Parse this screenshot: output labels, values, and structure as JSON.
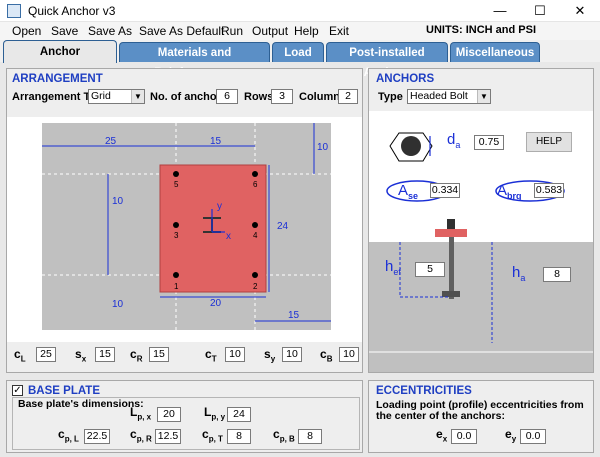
{
  "window": {
    "title": "Quick Anchor v3",
    "minimize": "—",
    "maximize": "☐",
    "close": "✕"
  },
  "menu": [
    "Open",
    "Save",
    "Save As",
    "Save As Default",
    "Run",
    "Output",
    "Help",
    "Exit"
  ],
  "units": "UNITS: INCH and PSI",
  "tabs": [
    "Anchor Arrangement",
    "Materials and Reinforcement",
    "Load",
    "Post-installed Anchors",
    "Miscellaneous"
  ],
  "arrangement": {
    "title": "ARRANGEMENT",
    "type_label": "Arrangement  Type",
    "type_value": "Grid",
    "num_anchors_label": "No. of anchors",
    "num_anchors": "6",
    "rows_label": "Rows",
    "rows": "3",
    "columns_label": "Columns",
    "columns": "2",
    "diagram": {
      "dim_top_left": "25",
      "dim_top_mid": "15",
      "dim_top_right": "10",
      "dim_left_upper": "10",
      "dim_left_lower": "10",
      "dim_right": "24",
      "dim_bottom_mid": "20",
      "dim_bottom_right": "15",
      "axis_x": "x",
      "axis_y": "y",
      "anchor_labels": [
        "1",
        "2",
        "3",
        "4",
        "5",
        "6"
      ]
    },
    "edge_fields": [
      {
        "sym": "c",
        "sub": "L",
        "value": "25"
      },
      {
        "sym": "s",
        "sub": "x",
        "value": "15"
      },
      {
        "sym": "c",
        "sub": "R",
        "value": "15"
      },
      {
        "sym": "c",
        "sub": "T",
        "value": "10"
      },
      {
        "sym": "s",
        "sub": "y",
        "value": "10"
      },
      {
        "sym": "c",
        "sub": "B",
        "value": "10"
      }
    ]
  },
  "anchors": {
    "title": "ANCHORS",
    "type_label": "Type",
    "type_value": "Headed Bolt",
    "da_sym": "d",
    "da_sub": "a",
    "da_value": "0.75",
    "help": "HELP",
    "ase_sym": "A",
    "ase_sub": "se",
    "ase_value": "0.334",
    "abrg_sym": "A",
    "abrg_sub": "brg",
    "abrg_value": "0.583",
    "hef_sym": "h",
    "hef_sub": "ef",
    "hef_value": "5",
    "ha_sym": "h",
    "ha_sub": "a",
    "ha_value": "8"
  },
  "baseplate": {
    "check": "✓",
    "title": "BASE PLATE",
    "dims_label": "Base plate's dimensions:",
    "row1": [
      {
        "sym": "L",
        "sub": "p, x",
        "value": "20"
      },
      {
        "sym": "L",
        "sub": "p, y",
        "value": "24"
      }
    ],
    "row2": [
      {
        "sym": "c",
        "sub": "p, L",
        "value": "22.5"
      },
      {
        "sym": "c",
        "sub": "p, R",
        "value": "12.5"
      },
      {
        "sym": "c",
        "sub": "p, T",
        "value": "8"
      },
      {
        "sym": "c",
        "sub": "p, B",
        "value": "8"
      }
    ]
  },
  "eccentricities": {
    "title": "ECCENTRICITIES",
    "desc": "Loading point (profile) eccentricities from the center of the anchors:",
    "fields": [
      {
        "sym": "e",
        "sub": "x",
        "value": "0.0"
      },
      {
        "sym": "e",
        "sub": "y",
        "value": "0.0"
      }
    ]
  },
  "colors": {
    "tab": "#5b8fc6",
    "title_blue": "#1f3fc2",
    "plate": "#e06060",
    "concrete": "#c0c0c0",
    "dim": "#1a2fd6"
  }
}
